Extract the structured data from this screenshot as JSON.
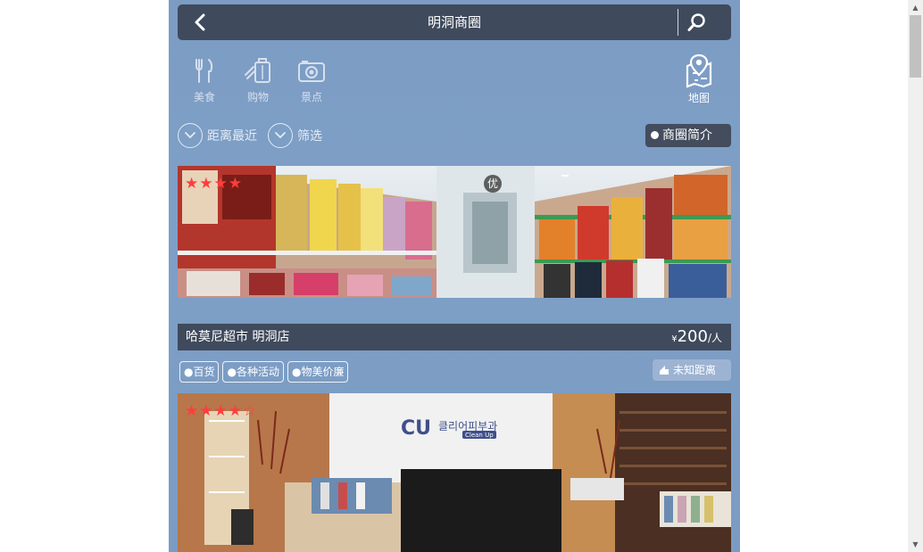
{
  "header": {
    "title": "明洞商圈"
  },
  "categories": [
    {
      "label": "美食",
      "icon": "fork-knife-icon"
    },
    {
      "label": "购物",
      "icon": "suitcase-icon"
    },
    {
      "label": "景点",
      "icon": "camera-icon"
    }
  ],
  "map": {
    "label": "地图",
    "icon": "map-pin-icon"
  },
  "filters": {
    "sort_label": "距离最近",
    "filter_label": "筛选",
    "intro_label": "商圈简介"
  },
  "listings": [
    {
      "rating": 3,
      "badge": "优",
      "name": "哈莫尼超市 明洞店",
      "price_currency": "¥",
      "price_value": "200",
      "price_unit": "/人",
      "tags": [
        "●百货",
        "●各种活动",
        "●物美价廉"
      ],
      "distance": "未知距离",
      "image": "supermarket-shelves-photo"
    },
    {
      "rating": 3.5,
      "image": "clinic-reception-photo",
      "logo_text": "CU",
      "logo_subtext": "클리어피부과",
      "logo_tag": "Clean Up"
    }
  ],
  "colors": {
    "accent_star": "#ff3d3d",
    "bar": "#3f4a5c",
    "background": "#7c9cc4"
  }
}
